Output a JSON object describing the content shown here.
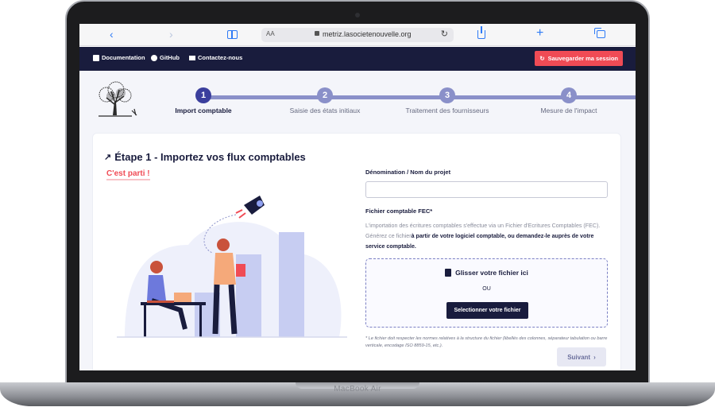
{
  "device": {
    "model_label": "MacBook Air"
  },
  "browser": {
    "back_icon": "chevron-left-icon",
    "forward_icon": "chevron-right-icon",
    "reader_label": "AA",
    "url": "metriz.lasocietenouvelle.org",
    "icons": [
      "book-icon",
      "lock-icon",
      "reload-icon",
      "share-icon",
      "plus-icon",
      "tabs-icon"
    ],
    "accent": "#2f7bf6"
  },
  "nav": {
    "links": [
      {
        "label": "Documentation",
        "icon": "doc-icon"
      },
      {
        "label": "GitHub",
        "icon": "github-icon"
      },
      {
        "label": "Contactez-nous",
        "icon": "mail-icon"
      }
    ],
    "save_label": "Sauvegarder ma session",
    "save_icon": "sync-icon",
    "background": "#191c3d",
    "save_color": "#f04b55"
  },
  "stepper": {
    "steps": [
      {
        "number": "1",
        "label": "Import comptable",
        "active": true
      },
      {
        "number": "2",
        "label": "Saisie des états initiaux",
        "active": false
      },
      {
        "number": "3",
        "label": "Traitement des fournisseurs",
        "active": false
      },
      {
        "number": "4",
        "label": "Mesure de l'impact",
        "active": false
      }
    ]
  },
  "main": {
    "title": "Étape 1 - Importez vos flux comptables",
    "title_icon": "trend-icon",
    "subtitle": "C'est parti !",
    "project_label": "Dénomination / Nom du projet",
    "project_value": "",
    "fec_label": "Fichier comptable FEC*",
    "fec_desc_pre": "L'importation des écritures comptables s'effectue via un Fichier d'Ecritures Comptables (FEC). Générez ce fichier",
    "fec_desc_bold": "à partir de votre logiciel comptable, ou demandez-le auprès de votre service comptable.",
    "drop_title": "Glisser votre fichier ici",
    "drop_icon": "file-plus-icon",
    "drop_or": "OU",
    "select_button": "Selectionner votre fichier",
    "note": "* Le fichier doit respecter les normes relatives à la structure du fichier (libellés des colonnes, séparateur tabulation ou barre verticale, encodage ISO 8859-15, etc.).",
    "next_button": "Suivant"
  }
}
